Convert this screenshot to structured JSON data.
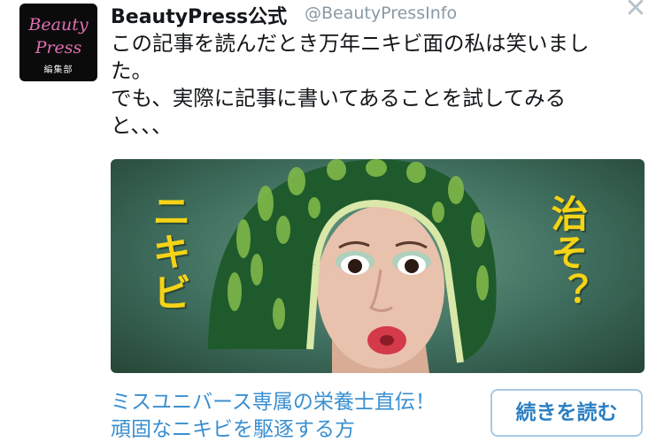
{
  "account": {
    "avatar_line1": "Beauty",
    "avatar_line2": "Press",
    "avatar_sub": "編集部",
    "name": "BeautyPress公式",
    "handle": "@BeautyPressInfo"
  },
  "close_glyph": "✕",
  "tweet": {
    "line1": "この記事を読んだとき万年ニキビ面の私は笑いまし",
    "line2": "た。",
    "line3": "でも、実際に記事に書いてあることを試してみる",
    "line4": "と、、、"
  },
  "media": {
    "left_text": "ニキビ",
    "right_text": "治そ？"
  },
  "card": {
    "title": "ミスユニバース専属の栄養士直伝！頑固なニキビを駆逐する方",
    "button_label": "続きを読む"
  },
  "colors": {
    "link": "#3a8fd0",
    "button_border": "#a8c9e4",
    "accent_yellow": "#f5d316"
  }
}
